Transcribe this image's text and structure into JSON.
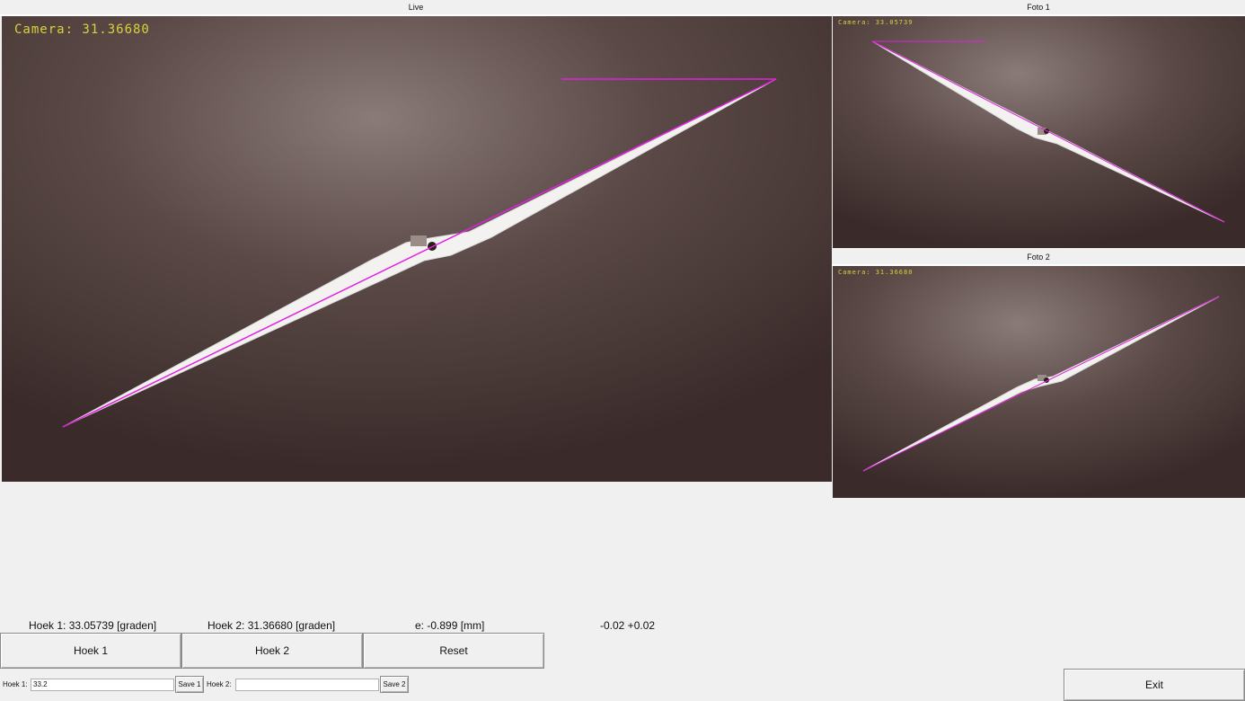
{
  "panels": {
    "live": {
      "title": "Live",
      "camera_label": "Camera: 31.36680"
    },
    "foto1": {
      "title": "Foto 1",
      "camera_label": "Camera: 33.05739"
    },
    "foto2": {
      "title": "Foto 2",
      "camera_label": "Camera: 31.36680"
    }
  },
  "readouts": {
    "hoek1": "Hoek 1: 33.05739 [graden]",
    "hoek2": "Hoek 2: 31.36680 [graden]",
    "e": "e: -0.899 [mm]",
    "tolerance": "-0.02 +0.02"
  },
  "buttons": {
    "hoek1": "Hoek 1",
    "hoek2": "Hoek 2",
    "reset": "Reset",
    "save1": "Save 1",
    "save2": "Save 2",
    "exit": "Exit"
  },
  "fields": {
    "hoek1_label": "Hoek 1:",
    "hoek1_value": "33.2",
    "hoek2_label": "Hoek 2:",
    "hoek2_value": ""
  },
  "colors": {
    "overlay_line": "#e020e0",
    "overlay_text": "#d8d23a",
    "background_cloth": "#4a3a36"
  }
}
